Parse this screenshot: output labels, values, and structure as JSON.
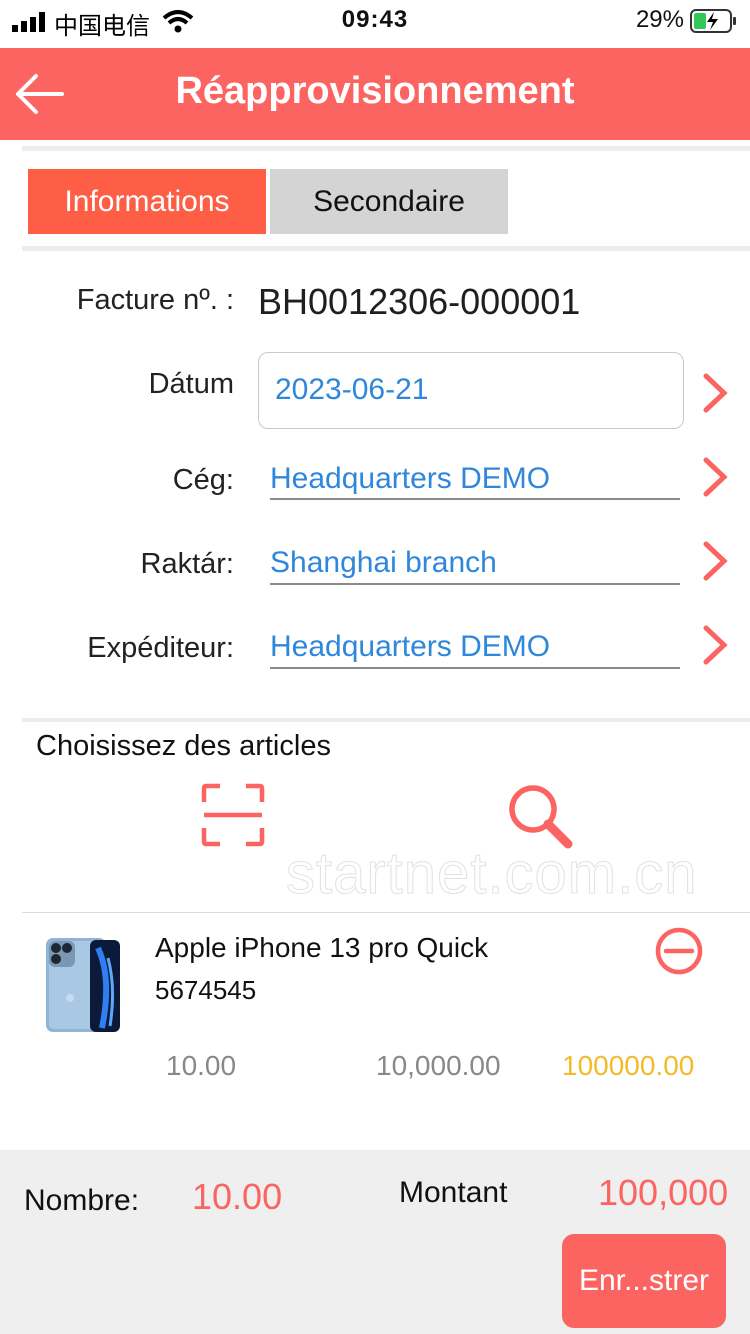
{
  "status_bar": {
    "carrier": "中国电信",
    "time": "09:43",
    "battery": "29%"
  },
  "header": {
    "title": "Réapprovisionnement",
    "back_icon": "arrow-left-icon",
    "color": "#fb6461"
  },
  "tabs": [
    {
      "label": "Informations",
      "active": true
    },
    {
      "label": "Secondaire",
      "active": false
    }
  ],
  "form": {
    "invoice_label": "Facture nº. :",
    "invoice_value": "BH0012306-000001",
    "date_label": "Dátum",
    "date_value": "2023-06-21",
    "company_label": "Cég:",
    "company_value": "Headquarters DEMO",
    "warehouse_label": "Raktár:",
    "warehouse_value": "Shanghai branch",
    "shipper_label": "Expéditeur:",
    "shipper_value": "Headquarters DEMO"
  },
  "articles": {
    "section_title": "Choisissez des articles",
    "scan_icon": "scan-icon",
    "search_icon": "search-icon",
    "watermark": "startnet.com.cn"
  },
  "items": [
    {
      "name": "Apple iPhone 13 pro Quick",
      "code": "5674545",
      "quantity": "10.00",
      "price": "10,000.00",
      "total": "100000.00"
    }
  ],
  "footer": {
    "count_label": "Nombre:",
    "count_value": "10.00",
    "amount_label": "Montant",
    "amount_value": "100,000",
    "save_label": "Enr...strer"
  }
}
